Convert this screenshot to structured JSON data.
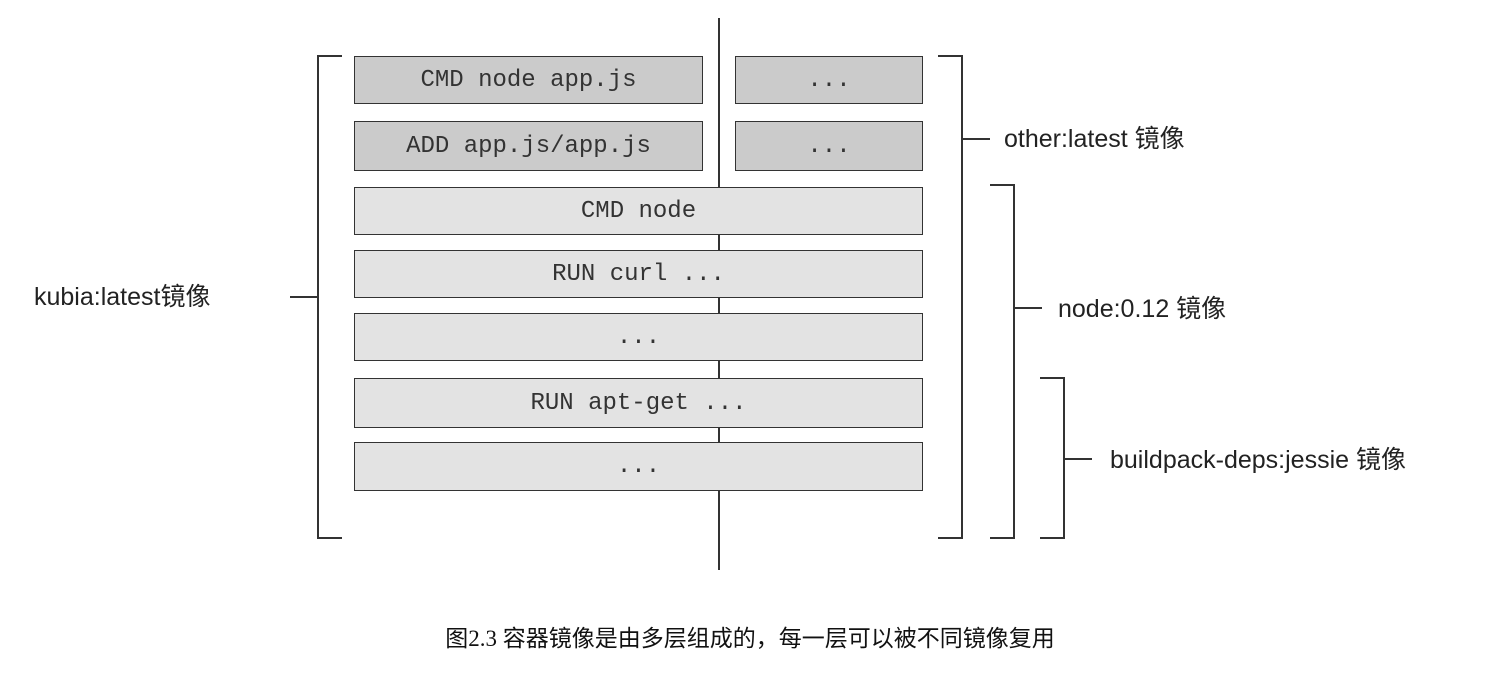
{
  "layers": {
    "cmd_node_app": "CMD node app.js",
    "add_app": "ADD app.js/app.js",
    "other_1": "...",
    "other_2": "...",
    "cmd_node": "CMD node",
    "run_curl": "RUN curl ...",
    "node_more": "...",
    "run_apt_get": "RUN apt-get ...",
    "base_more": "..."
  },
  "images": {
    "kubia": "kubia:latest镜像",
    "other": "other:latest 镜像",
    "node": "node:0.12 镜像",
    "buildpack": "buildpack-deps:jessie 镜像"
  },
  "caption": "图2.3 容器镜像是由多层组成的，每一层可以被不同镜像复用"
}
